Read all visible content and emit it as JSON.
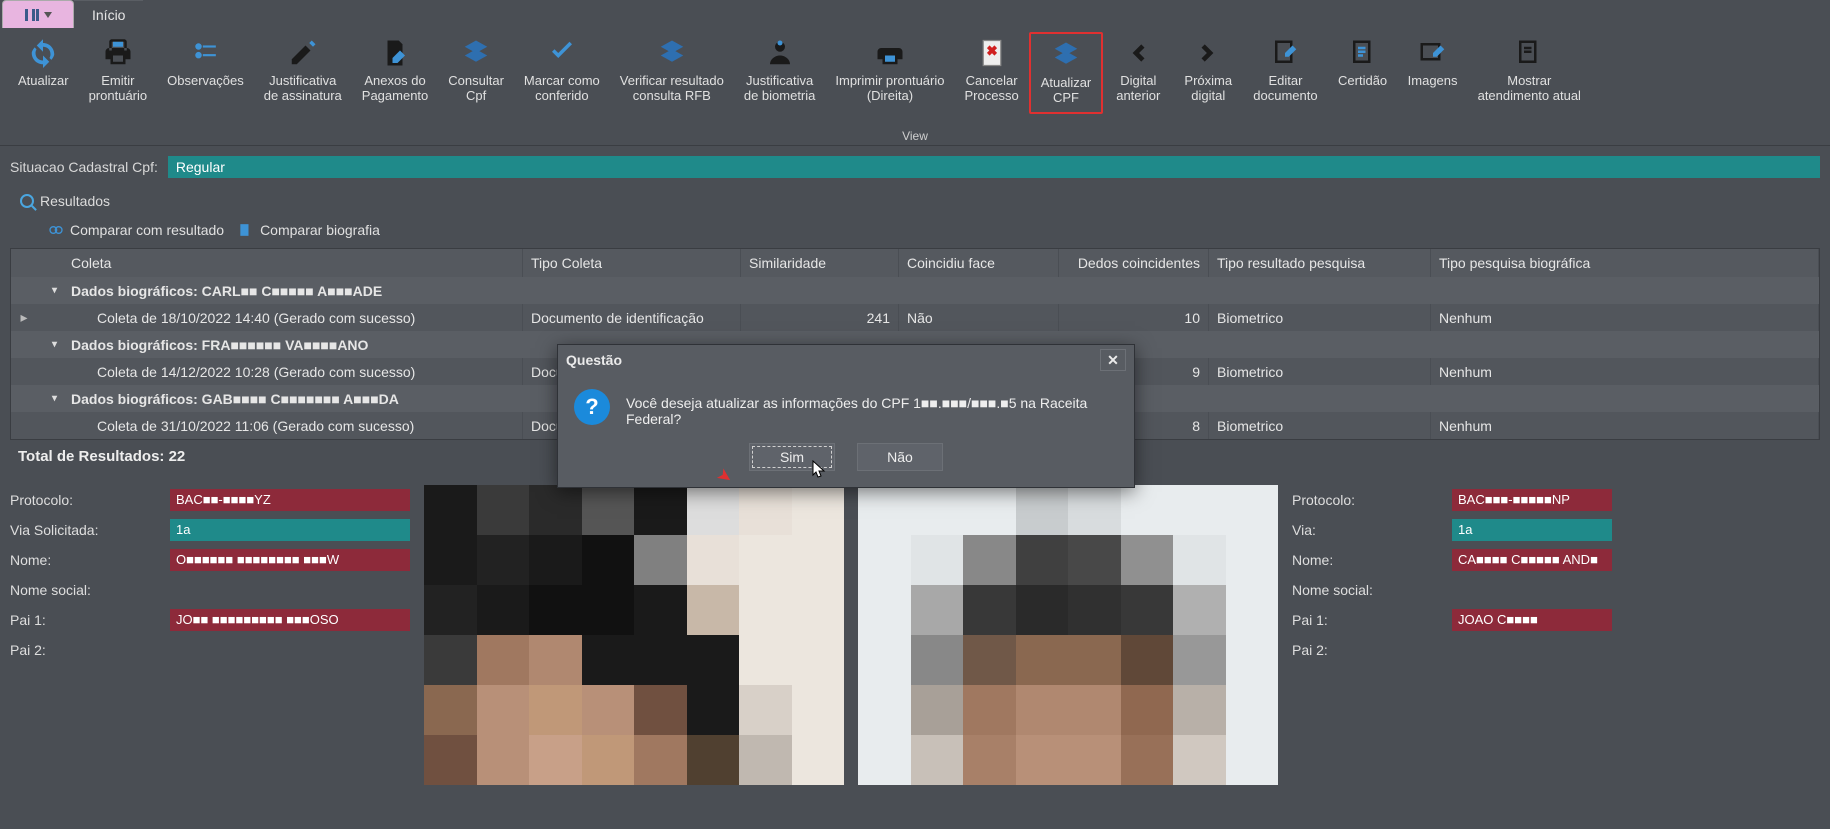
{
  "tab": {
    "inicio": "Início"
  },
  "ribbon": {
    "caption": "View",
    "items": [
      {
        "label1": "Atualizar",
        "label2": ""
      },
      {
        "label1": "Emitir",
        "label2": "prontuário"
      },
      {
        "label1": "Observações",
        "label2": ""
      },
      {
        "label1": "Justificativa",
        "label2": "de assinatura"
      },
      {
        "label1": "Anexos do",
        "label2": "Pagamento"
      },
      {
        "label1": "Consultar",
        "label2": "Cpf"
      },
      {
        "label1": "Marcar como",
        "label2": "conferido"
      },
      {
        "label1": "Verificar resultado",
        "label2": "consulta RFB"
      },
      {
        "label1": "Justificativa",
        "label2": "de biometria"
      },
      {
        "label1": "Imprimir prontuário",
        "label2": "(Direita)"
      },
      {
        "label1": "Cancelar",
        "label2": "Processo"
      },
      {
        "label1": "Atualizar",
        "label2": "CPF"
      },
      {
        "label1": "Digital",
        "label2": "anterior"
      },
      {
        "label1": "Próxima",
        "label2": "digital"
      },
      {
        "label1": "Editar",
        "label2": "documento"
      },
      {
        "label1": "Certidão",
        "label2": ""
      },
      {
        "label1": "Imagens",
        "label2": ""
      },
      {
        "label1": "Mostrar",
        "label2": "atendimento atual"
      }
    ]
  },
  "status": {
    "label": "Situacao Cadastral Cpf:",
    "value": "Regular"
  },
  "subtab": {
    "resultados": "Resultados"
  },
  "actions": {
    "comparar_resultado": "Comparar com resultado",
    "comparar_bio": "Comparar biografia"
  },
  "grid": {
    "headers": {
      "coleta": "Coleta",
      "tipo": "Tipo Coleta",
      "sim": "Similaridade",
      "coin": "Coincidiu face",
      "dedos": "Dedos coincidentes",
      "res": "Tipo resultado pesquisa",
      "bio": "Tipo pesquisa biográfica"
    },
    "rows": [
      {
        "type": "group",
        "label": "Dados biográficos: CARL■■ C■■■■■ A■■■ADE"
      },
      {
        "type": "data",
        "coleta": "Coleta de 18/10/2022 14:40 (Gerado com sucesso)",
        "tipo": "Documento de identificação",
        "sim": "241",
        "coin": "Não",
        "dedos": "10",
        "res": "Biometrico",
        "bio": "Nenhum",
        "marked": true
      },
      {
        "type": "group",
        "label": "Dados biográficos: FRA■■■■■■ VA■■■■ANO"
      },
      {
        "type": "data",
        "coleta": "Coleta de 14/12/2022 10:28 (Gerado com sucesso)",
        "tipo": "Document",
        "sim": "",
        "coin": "",
        "dedos": "9",
        "res": "Biometrico",
        "bio": "Nenhum"
      },
      {
        "type": "group",
        "label": "Dados biográficos: GAB■■■■ C■■■■■■■ A■■■DA"
      },
      {
        "type": "data",
        "coleta": "Coleta de 31/10/2022 11:06 (Gerado com sucesso)",
        "tipo": "Document",
        "sim": "",
        "coin": "",
        "dedos": "8",
        "res": "Biometrico",
        "bio": "Nenhum"
      }
    ],
    "totals": "Total de Resultados: 22"
  },
  "left": {
    "protocolo_k": "Protocolo:",
    "protocolo_v": "BAC■■-■■■■YZ",
    "via_k": "Via Solicitada:",
    "via_v": "1a",
    "nome_k": "Nome:",
    "nome_v": "O■■■■■■ ■■■■■■■■ ■■■W",
    "nomesoc_k": "Nome social:",
    "pai1_k": "Pai 1:",
    "pai1_v": "JO■■ ■■■■■■■■■ ■■■OSO",
    "pai2_k": "Pai 2:"
  },
  "right": {
    "protocolo_k": "Protocolo:",
    "protocolo_v": "BAC■■■-■■■■■NP",
    "via_k": "Via:",
    "via_v": "1a",
    "nome_k": "Nome:",
    "nome_v": "CA■■■■ C■■■■■ AND■",
    "nomesoc_k": "Nome social:",
    "pai1_k": "Pai 1:",
    "pai1_v": "JOAO C■■■■",
    "pai2_k": "Pai 2:"
  },
  "modal": {
    "title": "Questão",
    "msg": "Você deseja atualizar as informações do CPF 1■■.■■■/■■■.■5 na Raceita Federal?",
    "sim": "Sim",
    "nao": "Não"
  }
}
